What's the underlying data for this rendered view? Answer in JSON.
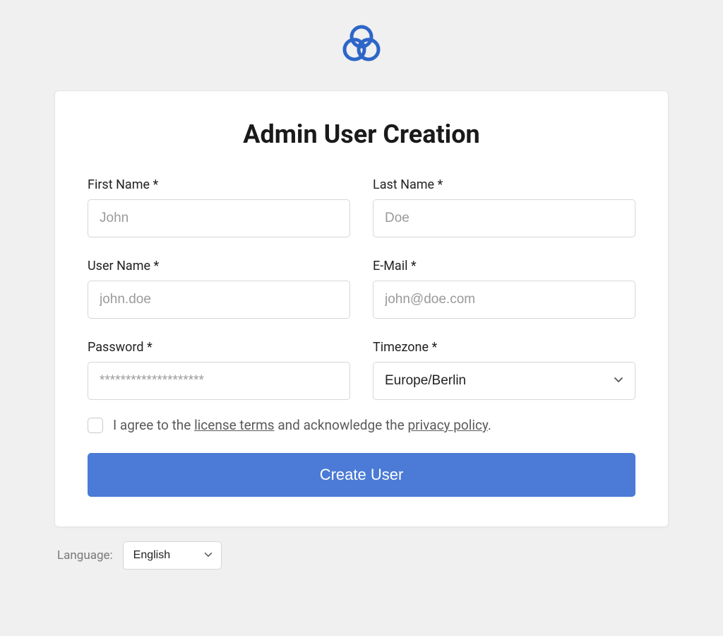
{
  "title": "Admin User Creation",
  "fields": {
    "first_name": {
      "label": "First Name *",
      "placeholder": "John"
    },
    "last_name": {
      "label": "Last Name *",
      "placeholder": "Doe"
    },
    "user_name": {
      "label": "User Name *",
      "placeholder": "john.doe"
    },
    "email": {
      "label": "E-Mail *",
      "placeholder": "john@doe.com"
    },
    "password": {
      "label": "Password *",
      "placeholder": "********************"
    },
    "timezone": {
      "label": "Timezone *",
      "value": "Europe/Berlin"
    }
  },
  "agreement": {
    "prefix": "I agree to the ",
    "license_link": "license terms",
    "middle": " and acknowledge the ",
    "privacy_link": "privacy policy",
    "suffix": "."
  },
  "submit_label": "Create User",
  "language": {
    "label": "Language:",
    "value": "English"
  }
}
